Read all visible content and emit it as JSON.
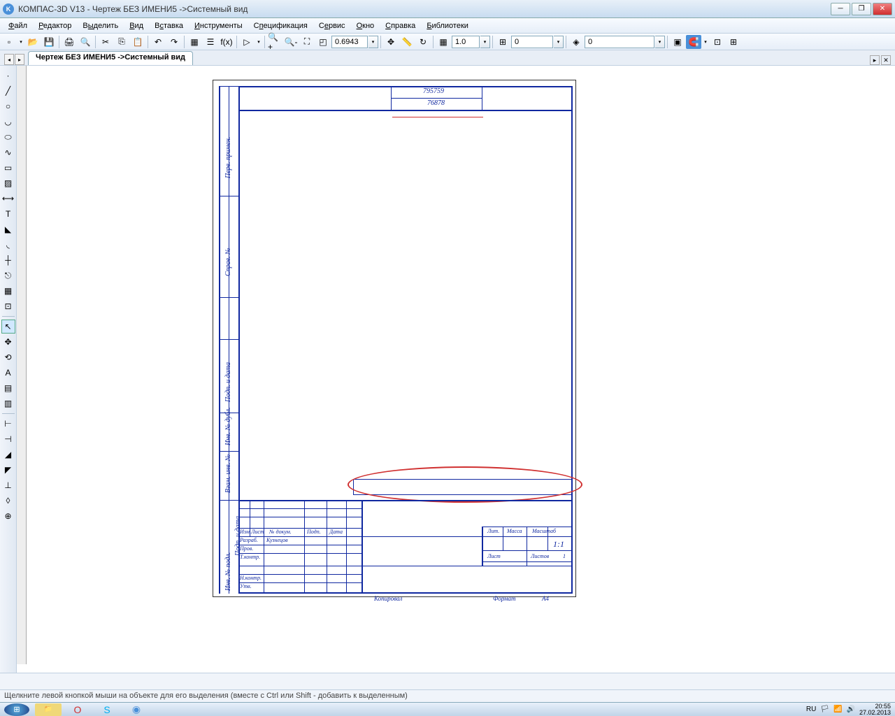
{
  "title": "КОМПАС-3D V13 - Чертеж БЕЗ ИМЕНИ5 ->Системный вид",
  "menu": [
    "Файл",
    "Редактор",
    "Выделить",
    "Вид",
    "Вставка",
    "Инструменты",
    "Спецификация",
    "Сервис",
    "Окно",
    "Справка",
    "Библиотеки"
  ],
  "menu_ul": [
    "Ф",
    "Р",
    "ы",
    "В",
    "с",
    "И",
    "п",
    "е",
    "О",
    "С",
    "Б"
  ],
  "zoom": "0.6943",
  "scale": "1.0",
  "coord": "0",
  "layer": "0",
  "tab": "Чертеж БЕЗ ИМЕНИ5 ->Системный вид",
  "drawing": {
    "num1": "795759",
    "num2": "76878",
    "side1": "Перв. примен.",
    "side2": "Справ. №",
    "side3": "Подп. и дата",
    "side4": "Инв. № дубл.",
    "side5": "Взам. инв. №",
    "side6": "Подп. и дата",
    "side7": "Инв. № подл.",
    "tb": {
      "izm": "Изм.",
      "list": "Лист",
      "ndok": "№ докум.",
      "podp": "Подп.",
      "data": "Дата",
      "razrab": "Разраб.",
      "author": "Кузнецов",
      "prov": "Пров.",
      "tkontr": "Т.контр.",
      "nkontr": "Н.контр.",
      "utv": "Утв.",
      "lit": "Лит.",
      "massa": "Масса",
      "masht": "Масштаб",
      "mval": "1:1",
      "list2": "Лист",
      "listov": "Листов",
      "lnum": "1",
      "kopir": "Копировал",
      "format": "Формат",
      "fval": "А4"
    }
  },
  "status": "Щелкните левой кнопкой мыши на объекте для его выделения (вместе с Ctrl или Shift - добавить к выделенным)",
  "tray": {
    "lang": "RU",
    "time": "20:55",
    "date": "27.02.2013"
  }
}
